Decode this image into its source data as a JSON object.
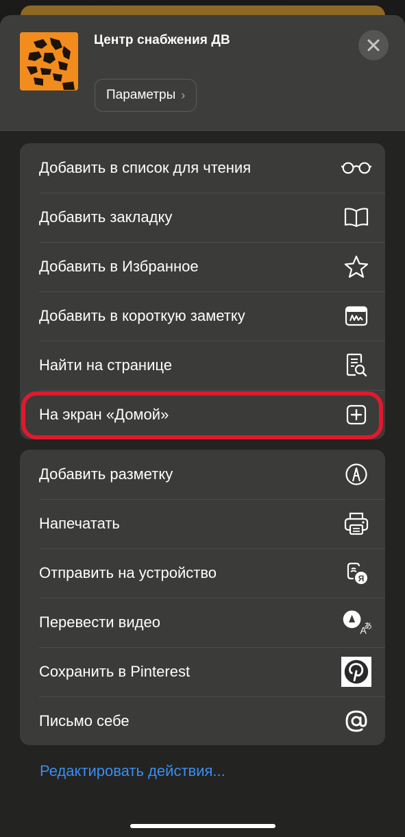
{
  "header": {
    "site_title": "Центр снабжения ДВ",
    "params_label": "Параметры",
    "params_chevron": "›",
    "close_icon": "×"
  },
  "actions_group1": [
    {
      "label": "Добавить в список для чтения",
      "icon": "reading-glasses-icon"
    },
    {
      "label": "Добавить закладку",
      "icon": "book-icon"
    },
    {
      "label": "Добавить в Избранное",
      "icon": "star-icon"
    },
    {
      "label": "Добавить в короткую заметку",
      "icon": "quick-note-icon"
    },
    {
      "label": "Найти на странице",
      "icon": "find-in-page-icon"
    },
    {
      "label": "На экран «Домой»",
      "icon": "add-square-icon"
    }
  ],
  "actions_group2": [
    {
      "label": "Добавить разметку",
      "icon": "markup-icon"
    },
    {
      "label": "Напечатать",
      "icon": "printer-icon"
    },
    {
      "label": "Отправить на устройство",
      "icon": "send-to-device-icon"
    },
    {
      "label": "Перевести видео",
      "icon": "translate-video-icon"
    },
    {
      "label": "Сохранить в Pinterest",
      "icon": "pinterest-icon"
    },
    {
      "label": "Письмо себе",
      "icon": "at-sign-icon"
    }
  ],
  "footer": {
    "edit_actions": "Редактировать действия..."
  },
  "colors": {
    "accent_link": "#3b8ef0",
    "highlight_ring": "#e0192c",
    "app_icon_bg": "#f28c1c"
  }
}
